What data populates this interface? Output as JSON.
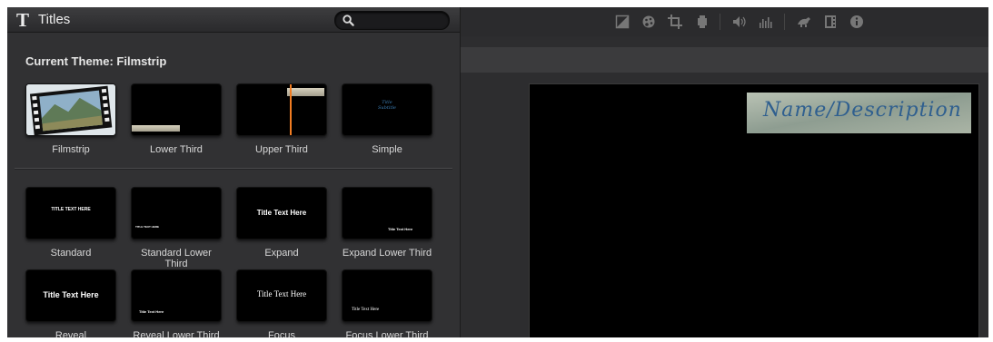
{
  "panel": {
    "title_glyph": "T",
    "title": "Titles",
    "search": {
      "value": "",
      "placeholder": ""
    },
    "theme_heading": "Current Theme: Filmstrip"
  },
  "theme_titles": [
    {
      "label": "Filmstrip"
    },
    {
      "label": "Lower Third"
    },
    {
      "label": "Upper Third"
    },
    {
      "label": "Simple",
      "thumb_text": "Title\nSubtitle"
    }
  ],
  "standard_titles": [
    {
      "label": "Standard",
      "thumb_text": "TITLE TEXT HERE"
    },
    {
      "label": "Standard Lower Third",
      "thumb_text": "TITLE TEXT HERE"
    },
    {
      "label": "Expand",
      "thumb_text": "Title Text Here"
    },
    {
      "label": "Expand Lower Third",
      "thumb_text": "Title Text Here"
    },
    {
      "label": "Reveal",
      "thumb_text": "Title Text Here"
    },
    {
      "label": "Reveal Lower Third",
      "thumb_text": "Title Text Here"
    },
    {
      "label": "Focus",
      "thumb_text": "Title Text Here"
    },
    {
      "label": "Focus Lower Third",
      "thumb_text": "Title Text Here"
    }
  ],
  "toolbar": {
    "icons": [
      "color-balance-icon",
      "color-correction-icon",
      "crop-icon",
      "stabilization-icon",
      "volume-icon",
      "equalizer-icon",
      "speed-icon",
      "clip-filter-icon",
      "info-icon"
    ]
  },
  "viewer": {
    "title_text": "Name/Description"
  },
  "colors": {
    "panel_bg": "#313133",
    "viewer_bg": "#000000",
    "title_ink": "#2f5f8f"
  }
}
